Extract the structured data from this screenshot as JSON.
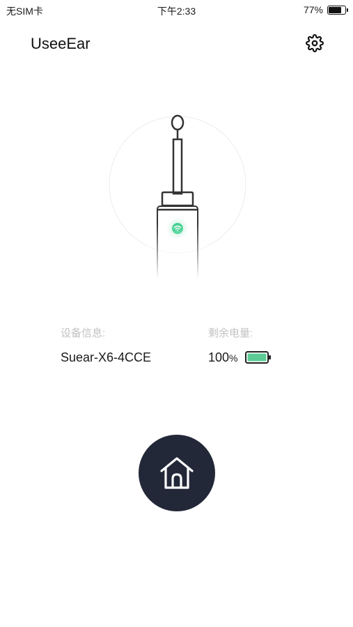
{
  "status_bar": {
    "carrier": "无SIM卡",
    "time": "下午2:33",
    "battery_percent": "77%",
    "battery_level": 0.77
  },
  "header": {
    "title": "UseeEar",
    "settings_icon": "gear-icon"
  },
  "illustration": {
    "icon": "ear-pick-device-icon",
    "indicator_icon": "wifi-icon",
    "indicator_color": "#3ecf8e"
  },
  "device_info": {
    "label": "设备信息:",
    "value": "Suear-X6-4CCE"
  },
  "battery": {
    "label": "剩余电量:",
    "value": "100",
    "unit": "%",
    "level": 1.0,
    "color": "#5ccc94"
  },
  "home_button": {
    "icon": "home-icon",
    "color": "#222838"
  }
}
